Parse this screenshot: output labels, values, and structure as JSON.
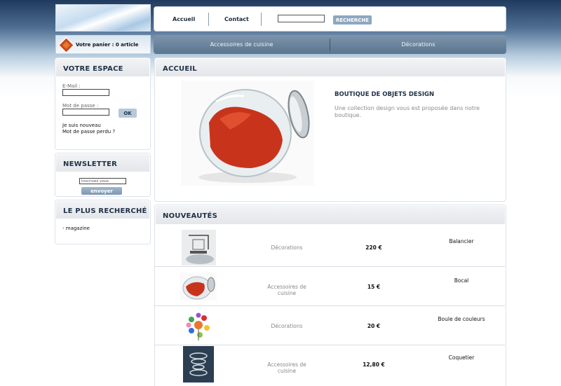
{
  "header": {
    "nav_links": [
      "Accueil",
      "Contact"
    ],
    "search_button": "RECHERCHE"
  },
  "cart": {
    "text": "Votre panier : 0 article"
  },
  "menu": {
    "items": [
      "Accessoires de cuisine",
      "Décorations"
    ]
  },
  "votre_espace": {
    "title": "VOTRE ESPACE",
    "email_label": "E-Mail :",
    "password_label": "Mot de passe :",
    "ok_button": "OK",
    "links": [
      "Je suis nouveau",
      "Mot de passe perdu ?"
    ]
  },
  "newsletter": {
    "title": "NEWSLETTER",
    "input_value": "Inscrivez vous",
    "submit_button": "envoyer"
  },
  "plus_recherche": {
    "title": "LE PLUS RECHERCHÉ",
    "items": [
      "- magazine"
    ]
  },
  "accueil": {
    "title": "ACCUEIL",
    "heading": "BOUTIQUE DE OBJETS DESIGN",
    "description": "Une collection design vous est proposée dans notre boutique."
  },
  "nouveautes": {
    "title": "NOUVEAUTÉS",
    "products": [
      {
        "category": "Décorations",
        "price": "220 €",
        "name": "Balancier"
      },
      {
        "category": "Accessoires de cuisine",
        "price": "15 €",
        "name": "Bocal"
      },
      {
        "category": "Décorations",
        "price": "20 €",
        "name": "Boule de couleurs"
      },
      {
        "category": "Accessoires de cuisine",
        "price": "12,80 €",
        "name": "Coquetier"
      }
    ]
  },
  "colors": {
    "accent": "#5b7590",
    "heading": "#1f3147",
    "panel_header": "#e4e6ea"
  }
}
